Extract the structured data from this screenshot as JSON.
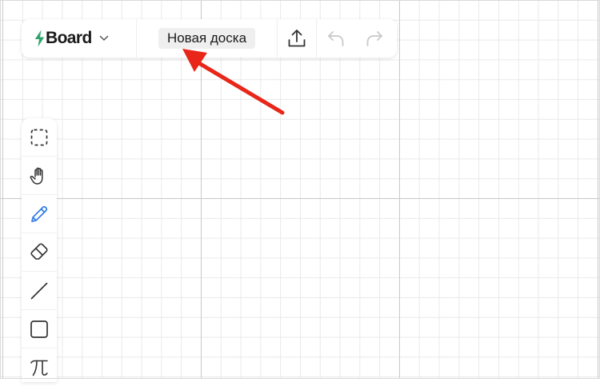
{
  "app": {
    "brand": "Board"
  },
  "board": {
    "title": "Новая доска"
  },
  "colors": {
    "brand_green": "#2ea36d",
    "active_tool": "#2f7be5",
    "annotation_arrow": "#e8261a",
    "icon_dark": "#333333",
    "icon_disabled": "#c8c8c8"
  },
  "header": {
    "icons": [
      "bolt-logo-icon",
      "chevron-down-icon",
      "share-upload-icon",
      "undo-icon",
      "redo-icon"
    ],
    "undo_enabled": false,
    "redo_enabled": false
  },
  "toolbar": {
    "tools": [
      {
        "name": "select",
        "icon": "dashed-select-icon",
        "active": false
      },
      {
        "name": "hand",
        "icon": "hand-icon",
        "active": false
      },
      {
        "name": "pen",
        "icon": "pencil-icon",
        "active": true
      },
      {
        "name": "eraser",
        "icon": "eraser-icon",
        "active": false
      },
      {
        "name": "line",
        "icon": "line-icon",
        "active": false
      },
      {
        "name": "rectangle",
        "icon": "square-icon",
        "active": false
      },
      {
        "name": "formula",
        "icon": "pi-icon",
        "active": false
      }
    ]
  },
  "annotation": {
    "type": "arrow",
    "target": "board-title",
    "color": "#e8261a"
  }
}
